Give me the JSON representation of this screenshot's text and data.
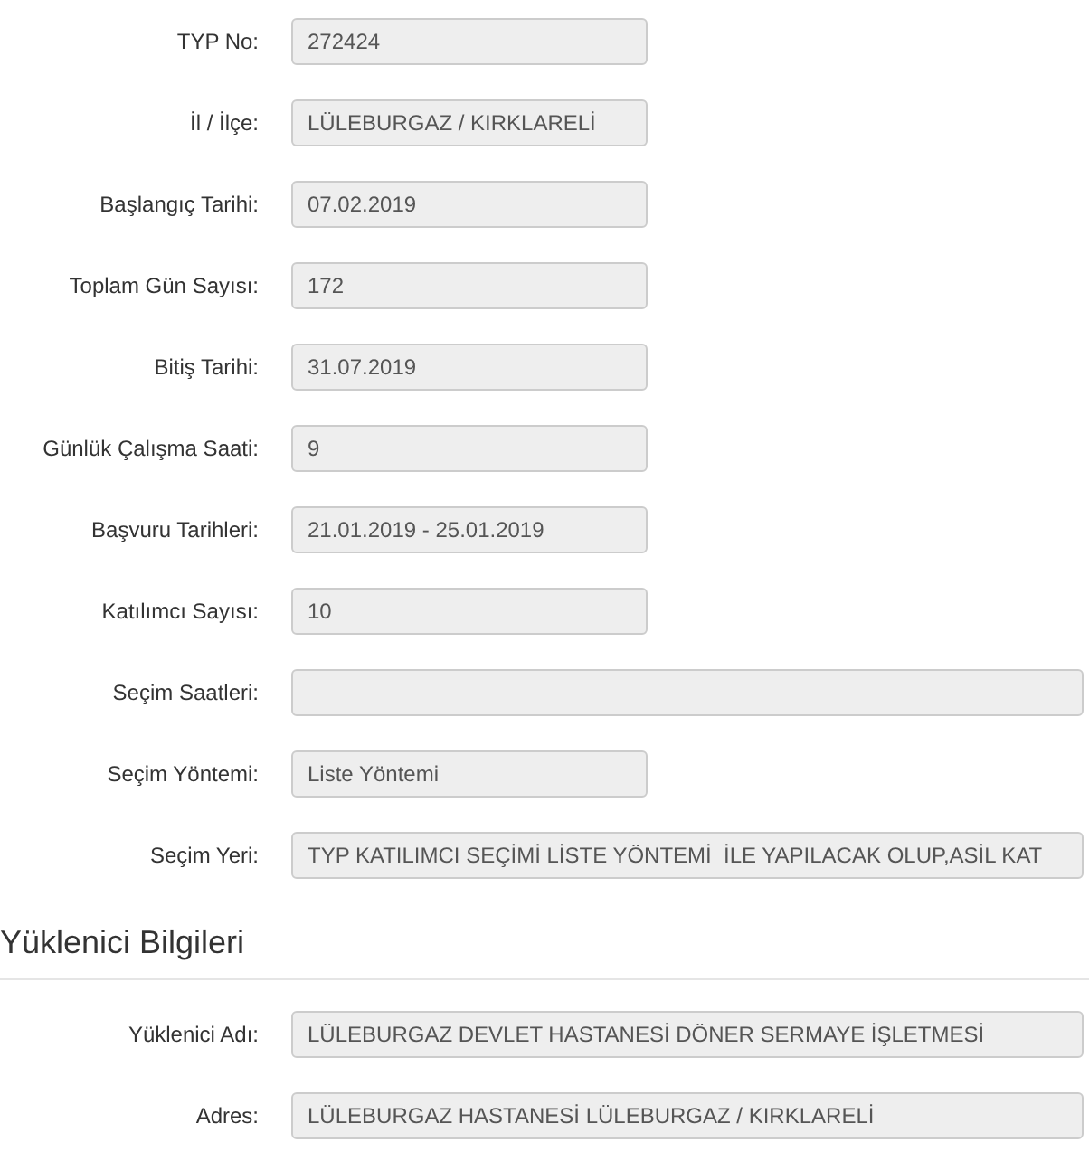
{
  "fields": [
    {
      "label": "TYP No:",
      "value": "272424",
      "kind": "short"
    },
    {
      "label": "İl / İlçe:",
      "value": "LÜLEBURGAZ / KIRKLARELİ",
      "kind": "short"
    },
    {
      "label": "Başlangıç Tarihi:",
      "value": "07.02.2019",
      "kind": "short"
    },
    {
      "label": "Toplam Gün Sayısı:",
      "value": "172",
      "kind": "short"
    },
    {
      "label": "Bitiş Tarihi:",
      "value": "31.07.2019",
      "kind": "short"
    },
    {
      "label": "Günlük Çalışma Saati:",
      "value": "9",
      "kind": "short"
    },
    {
      "label": "Başvuru Tarihleri:",
      "value": "21.01.2019 - 25.01.2019",
      "kind": "short"
    },
    {
      "label": "Katılımcı Sayısı:",
      "value": "10",
      "kind": "short"
    },
    {
      "label": "Seçim Saatleri:",
      "kind": "wide"
    },
    {
      "label": "Seçim Yöntemi:",
      "value": "Liste Yöntemi",
      "kind": "short"
    },
    {
      "label": "Seçim Yeri:",
      "value": "TYP KATILIMCI SEÇİMİ LİSTE YÖNTEMİ  İLE YAPILACAK OLUP,ASİL KAT",
      "kind": "wide"
    }
  ],
  "contractor": {
    "heading": "Yüklenici Bilgileri",
    "fields": [
      {
        "label": "Yüklenici Adı:",
        "value": "LÜLEBURGAZ DEVLET HASTANESİ DÖNER SERMAYE İŞLETMESİ",
        "kind": "wide"
      },
      {
        "label": "Adres:",
        "value": "LÜLEBURGAZ HASTANESİ LÜLEBURGAZ / KIRKLARELİ",
        "kind": "wide"
      }
    ]
  }
}
